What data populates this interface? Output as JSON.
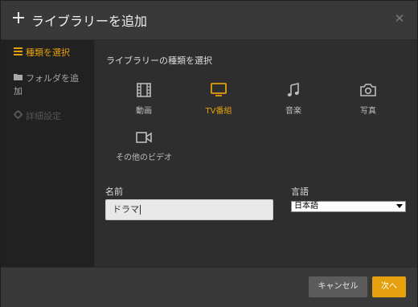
{
  "header": {
    "title": "ライブラリーを追加",
    "close_glyph": "✕"
  },
  "sidebar": {
    "items": [
      {
        "label": "種類を選択",
        "icon": "list-icon",
        "state": "active"
      },
      {
        "label": "フォルダを追加",
        "icon": "folder-icon",
        "state": "normal"
      },
      {
        "label": "詳細設定",
        "icon": "gear-icon",
        "state": "disabled"
      }
    ]
  },
  "main": {
    "section_title": "ライブラリーの種類を選択",
    "types": [
      {
        "label": "動画",
        "icon": "film-icon",
        "selected": false
      },
      {
        "label": "TV番組",
        "icon": "tv-icon",
        "selected": true
      },
      {
        "label": "音楽",
        "icon": "music-note-icon",
        "selected": false
      },
      {
        "label": "写真",
        "icon": "camera-icon",
        "selected": false
      },
      {
        "label": "その他のビデオ",
        "icon": "video-camera-icon",
        "selected": false
      }
    ],
    "name_label": "名前",
    "name_value": "ドラマ",
    "language_label": "言語",
    "language_value": "日本語"
  },
  "footer": {
    "cancel_label": "キャンセル",
    "next_label": "次へ"
  },
  "colors": {
    "accent": "#e5a00d",
    "background": "#2e2e2e",
    "sidebar": "#212121",
    "header": "#393939"
  }
}
